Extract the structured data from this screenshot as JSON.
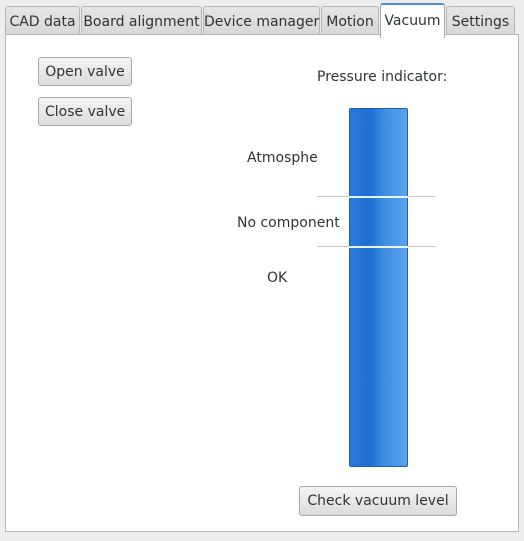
{
  "tabs": [
    {
      "label": "CAD data",
      "active": false
    },
    {
      "label": "Board alignment",
      "active": false
    },
    {
      "label": "Device manager",
      "active": false
    },
    {
      "label": "Motion",
      "active": false
    },
    {
      "label": "Vacuum",
      "active": true
    },
    {
      "label": "Settings",
      "active": false
    }
  ],
  "buttons": {
    "open_valve": "Open valve",
    "close_valve": "Close valve",
    "check_vacuum": "Check vacuum level"
  },
  "pressure": {
    "title": "Pressure indicator:",
    "levels": [
      "Atmosphe",
      "No component",
      "OK"
    ],
    "fill_fraction": 1.0
  },
  "colors": {
    "accent": "#4a90d9",
    "bar": "#1d6fd6"
  }
}
